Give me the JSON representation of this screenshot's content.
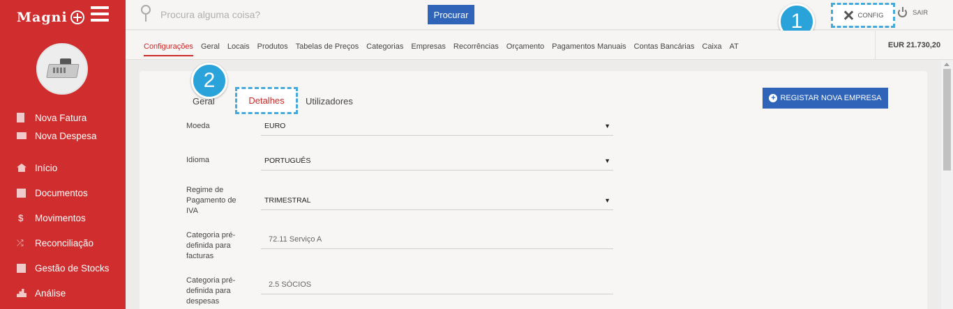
{
  "sidebar": {
    "logo": "Magni",
    "menu_icon": "hamburger-menu-icon",
    "quick_items": [
      {
        "label": "Nova Fatura",
        "icon": "document-icon"
      },
      {
        "label": "Nova Despesa",
        "icon": "expense-icon"
      }
    ],
    "items": [
      {
        "label": "Início",
        "icon": "home-icon"
      },
      {
        "label": "Documentos",
        "icon": "documents-icon"
      },
      {
        "label": "Movimentos",
        "icon": "dollar-icon"
      },
      {
        "label": "Reconciliação",
        "icon": "shuffle-icon"
      },
      {
        "label": "Gestão de Stocks",
        "icon": "stocks-icon"
      },
      {
        "label": "Análise",
        "icon": "chart-icon"
      }
    ],
    "accent_color": "#d02e2e"
  },
  "topbar": {
    "search_placeholder": "Procura alguma coisa?",
    "search_button": "Procurar",
    "config_label": "CONFIG",
    "logout_label": "SAIR"
  },
  "badges": {
    "one": "1",
    "two": "2"
  },
  "subnav": {
    "items": [
      "Configurações",
      "Geral",
      "Locais",
      "Produtos",
      "Tabelas de Preços",
      "Categorias",
      "Empresas",
      "Recorrências",
      "Orçamento",
      "Pagamentos Manuais",
      "Contas Bancárias",
      "Caixa",
      "AT"
    ],
    "active": "Configurações",
    "balance": "EUR 21.730,20"
  },
  "company": {
    "tabs": {
      "geral": "Geral",
      "detalhes": "Detalhes",
      "utilizadores": "Utilizadores"
    },
    "active_tab": "Detalhes",
    "register_button": "REGISTAR NOVA EMPRESA",
    "fields": {
      "moeda": {
        "label": "Moeda",
        "value": "EURO"
      },
      "idioma": {
        "label": "Idioma",
        "value": "PORTUGUÊS"
      },
      "regime": {
        "label": "Regime de Pagamento de IVA",
        "value": "TRIMESTRAL"
      },
      "cat_faturas": {
        "label": "Categoria pré-definida para facturas",
        "value": "72.11 Serviço A"
      },
      "cat_despesas": {
        "label": "Categoria pré-definida para despesas",
        "value": "2.5 SÓCIOS"
      }
    }
  },
  "colors": {
    "primary_button": "#2f64b8",
    "highlight": "#45a9da",
    "active_tab": "#c92a2a"
  }
}
